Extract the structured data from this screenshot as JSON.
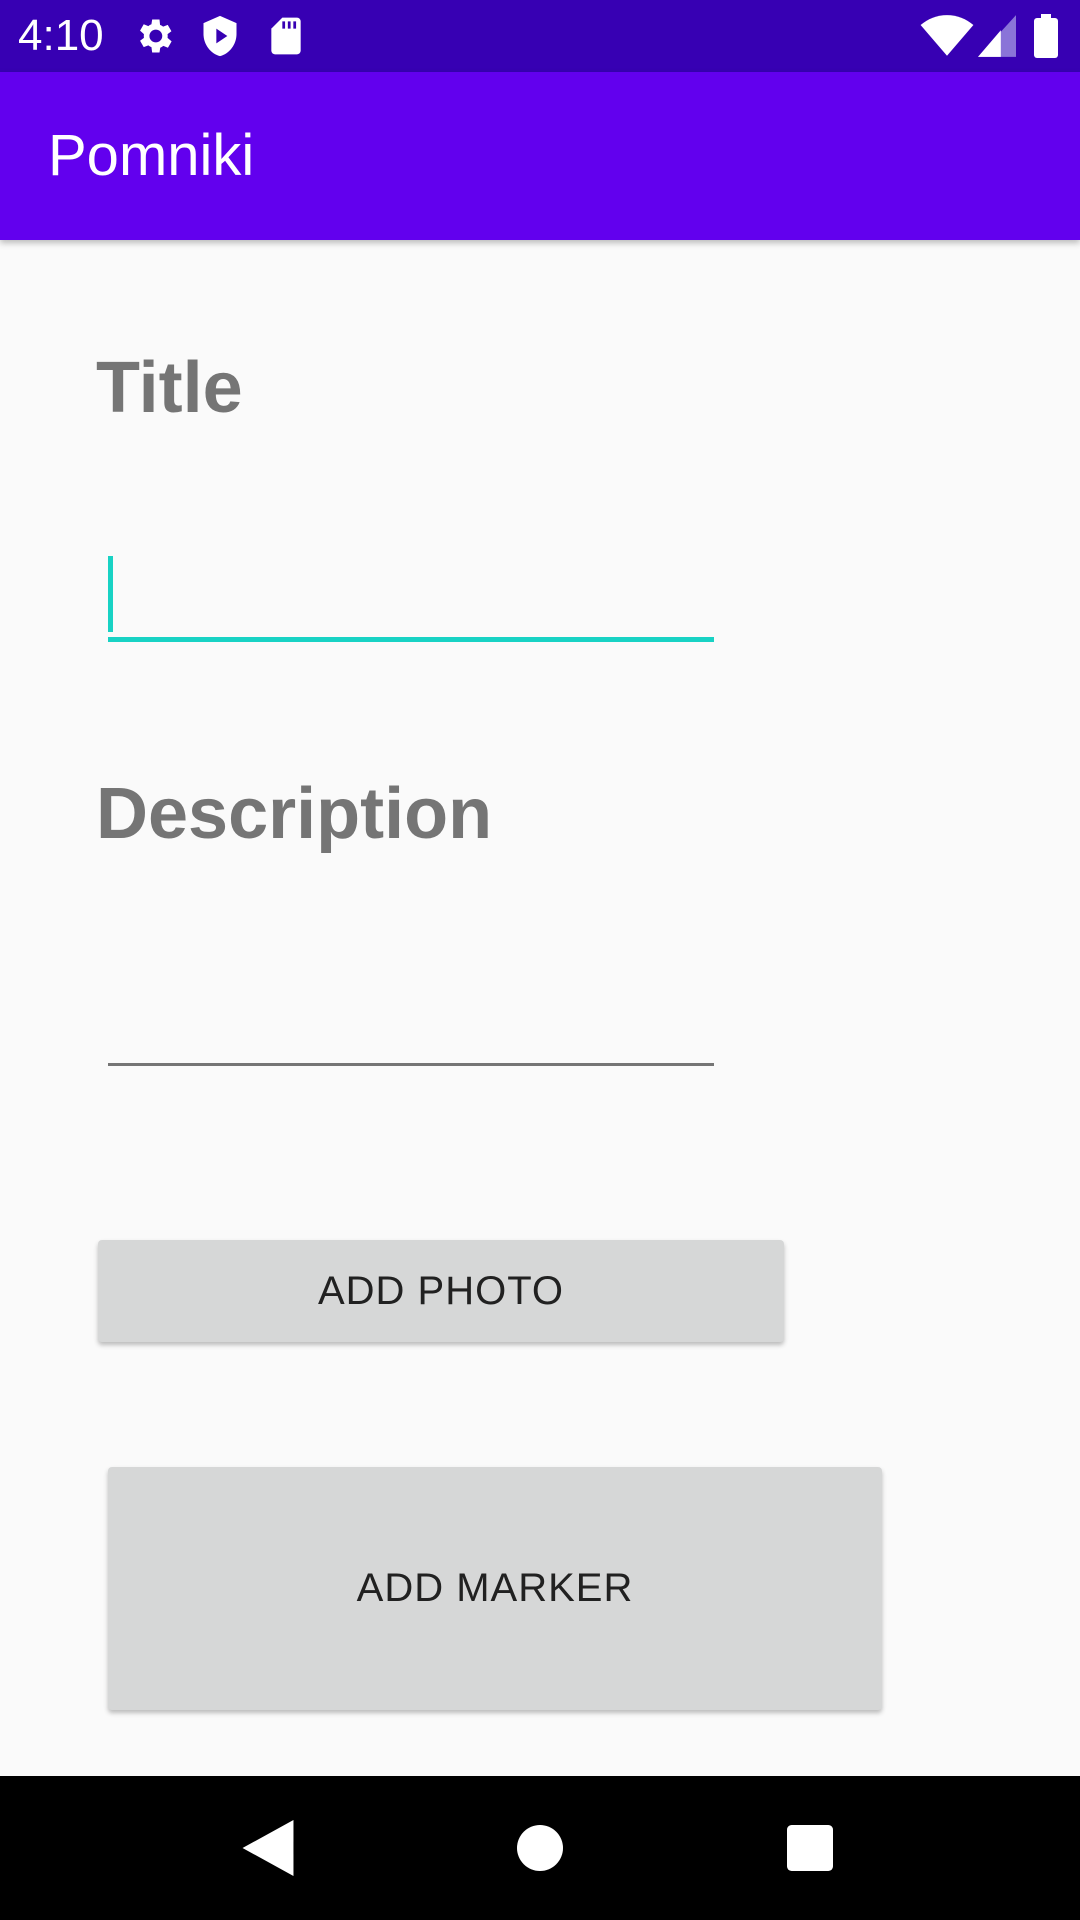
{
  "status_bar": {
    "time": "4:10",
    "left_icons": [
      "gear-icon",
      "shield-play-icon",
      "sd-card-icon"
    ],
    "right_icons": [
      "wifi-icon",
      "cell-signal-icon",
      "battery-icon"
    ]
  },
  "app_bar": {
    "title": "Pomniki",
    "color": "#6200ee"
  },
  "form": {
    "title_label": "Title",
    "title_value": "",
    "description_label": "Description",
    "description_value": "",
    "accent_color": "#18d2c4"
  },
  "buttons": {
    "add_photo": "ADD PHOTO",
    "add_marker": "ADD MARKER"
  },
  "nav_bar": {
    "icons": [
      "back-icon",
      "home-icon",
      "recents-icon"
    ]
  }
}
